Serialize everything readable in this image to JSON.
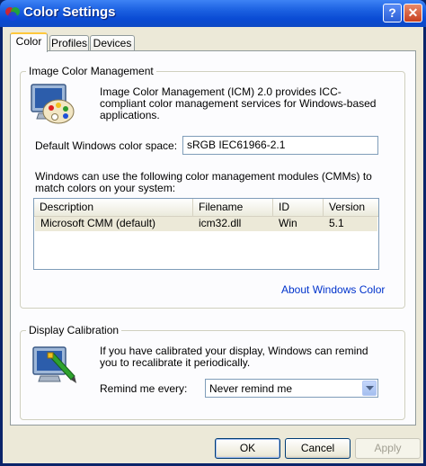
{
  "window": {
    "title": "Color Settings",
    "help_glyph": "?",
    "close_glyph": "✕"
  },
  "tabs": [
    {
      "label": "Color",
      "active": true
    },
    {
      "label": "Profiles"
    },
    {
      "label": "Devices"
    }
  ],
  "icm": {
    "legend": "Image Color Management",
    "desc_lines": [
      "Image Color Management (ICM) 2.0 provides ICC-",
      "compliant color management services for Windows-based",
      "applications."
    ],
    "default_space_label": "Default Windows color space:",
    "default_space_value": "sRGB IEC61966-2.1",
    "cmm_text_lines": [
      "Windows can use the following color management modules (CMMs) to",
      "match colors on your system:"
    ],
    "columns": [
      "Description",
      "Filename",
      "ID",
      "Version"
    ],
    "rows": [
      {
        "description": "Microsoft CMM (default)",
        "filename": "icm32.dll",
        "id": "Win",
        "version": "5.1"
      }
    ],
    "about_link": "About Windows Color"
  },
  "calibration": {
    "legend": "Display Calibration",
    "text_lines": [
      "If you have calibrated your display, Windows can remind",
      "you to recalibrate it periodically."
    ],
    "remind_label": "Remind me every:",
    "remind_value": "Never remind me"
  },
  "buttons": {
    "ok": "OK",
    "cancel": "Cancel",
    "apply": "Apply"
  }
}
